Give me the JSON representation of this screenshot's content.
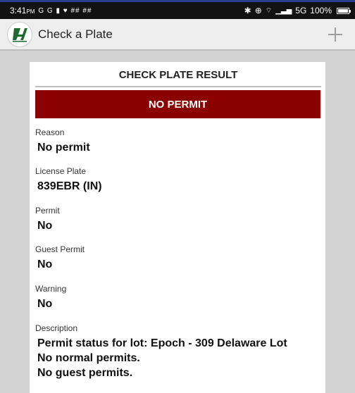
{
  "status_bar": {
    "time": "3:41",
    "ampm": "PM",
    "notifications": "G G ▮ ♥ ## ##",
    "network": "5G",
    "battery": "100%",
    "icons": [
      "bluetooth-icon",
      "location-icon",
      "wifi-icon",
      "signal-icon",
      "battery-icon"
    ]
  },
  "app_bar": {
    "title": "Check a Plate",
    "logo_icon": "app-logo-icon",
    "action_icon": "add-icon"
  },
  "result": {
    "title": "CHECK PLATE RESULT",
    "banner": "NO PERMIT",
    "banner_color": "#8b0000",
    "fields": [
      {
        "label": "Reason",
        "value": "No permit"
      },
      {
        "label": "License Plate",
        "value": "839EBR (IN)"
      },
      {
        "label": "Permit",
        "value": "No"
      },
      {
        "label": "Guest Permit",
        "value": "No"
      },
      {
        "label": "Warning",
        "value": "No"
      }
    ],
    "description": {
      "label": "Description",
      "lines": [
        "Permit status for lot: Epoch - 309 Delaware Lot",
        "No normal permits.",
        "No guest permits."
      ]
    }
  }
}
